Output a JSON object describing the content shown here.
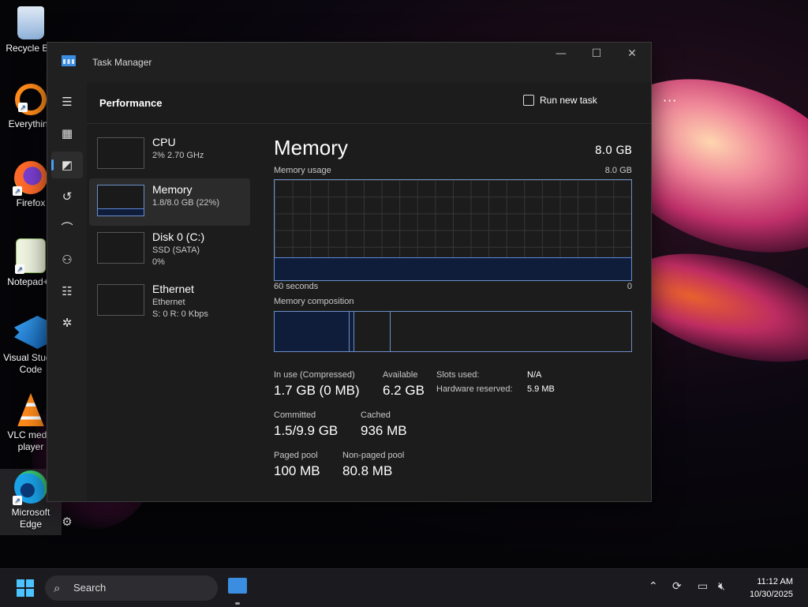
{
  "desktop": {
    "icons": [
      {
        "label": "Recycle Bin",
        "icon": "recycle-bin-icon"
      },
      {
        "label": "Everything",
        "icon": "everything-icon"
      },
      {
        "label": "Firefox",
        "icon": "firefox-icon"
      },
      {
        "label": "Notepad++",
        "icon": "notepad-plus-plus-icon"
      },
      {
        "label": "Visual Studio Code",
        "icon": "vscode-icon"
      },
      {
        "label": "VLC media player",
        "icon": "vlc-icon"
      },
      {
        "label": "Microsoft Edge",
        "icon": "edge-icon"
      }
    ]
  },
  "window": {
    "title": "Task Manager",
    "controls": {
      "minimize": "—",
      "maximize": "☐",
      "close": "✕"
    }
  },
  "header": {
    "page_title": "Performance",
    "run_new_task": "Run new task",
    "more": "···"
  },
  "perf_list": [
    {
      "name": "CPU",
      "sub1": "2% 2.70 GHz",
      "sub2": ""
    },
    {
      "name": "Memory",
      "sub1": "1.8/8.0 GB (22%)",
      "sub2": ""
    },
    {
      "name": "Disk 0 (C:)",
      "sub1": "SSD (SATA)",
      "sub2": "0%"
    },
    {
      "name": "Ethernet",
      "sub1": "Ethernet",
      "sub2": "S: 0 R: 0 Kbps"
    }
  ],
  "detail": {
    "title": "Memory",
    "total": "8.0 GB",
    "usage_label": "Memory usage",
    "usage_max": "8.0 GB",
    "usage_fraction": 0.22,
    "time_left": "60 seconds",
    "time_right": "0",
    "composition_label": "Memory composition",
    "stats": {
      "in_use_label": "In use (Compressed)",
      "in_use_value": "1.7 GB (0 MB)",
      "available_label": "Available",
      "available_value": "6.2 GB",
      "committed_label": "Committed",
      "committed_value": "1.5/9.9 GB",
      "cached_label": "Cached",
      "cached_value": "936 MB",
      "paged_label": "Paged pool",
      "paged_value": "100 MB",
      "nonpaged_label": "Non-paged pool",
      "nonpaged_value": "80.8 MB",
      "slots_label": "Slots used:",
      "slots_value": "N/A",
      "hw_reserved_label": "Hardware reserved:",
      "hw_reserved_value": "5.9 MB"
    }
  },
  "taskbar": {
    "search_placeholder": "Search",
    "time": "11:12 AM",
    "date": "10/30/2025"
  },
  "colors": {
    "accent": "#4aa0f0",
    "chart_border": "#6b8fc7",
    "chart_fill": "#0f1d3a"
  }
}
